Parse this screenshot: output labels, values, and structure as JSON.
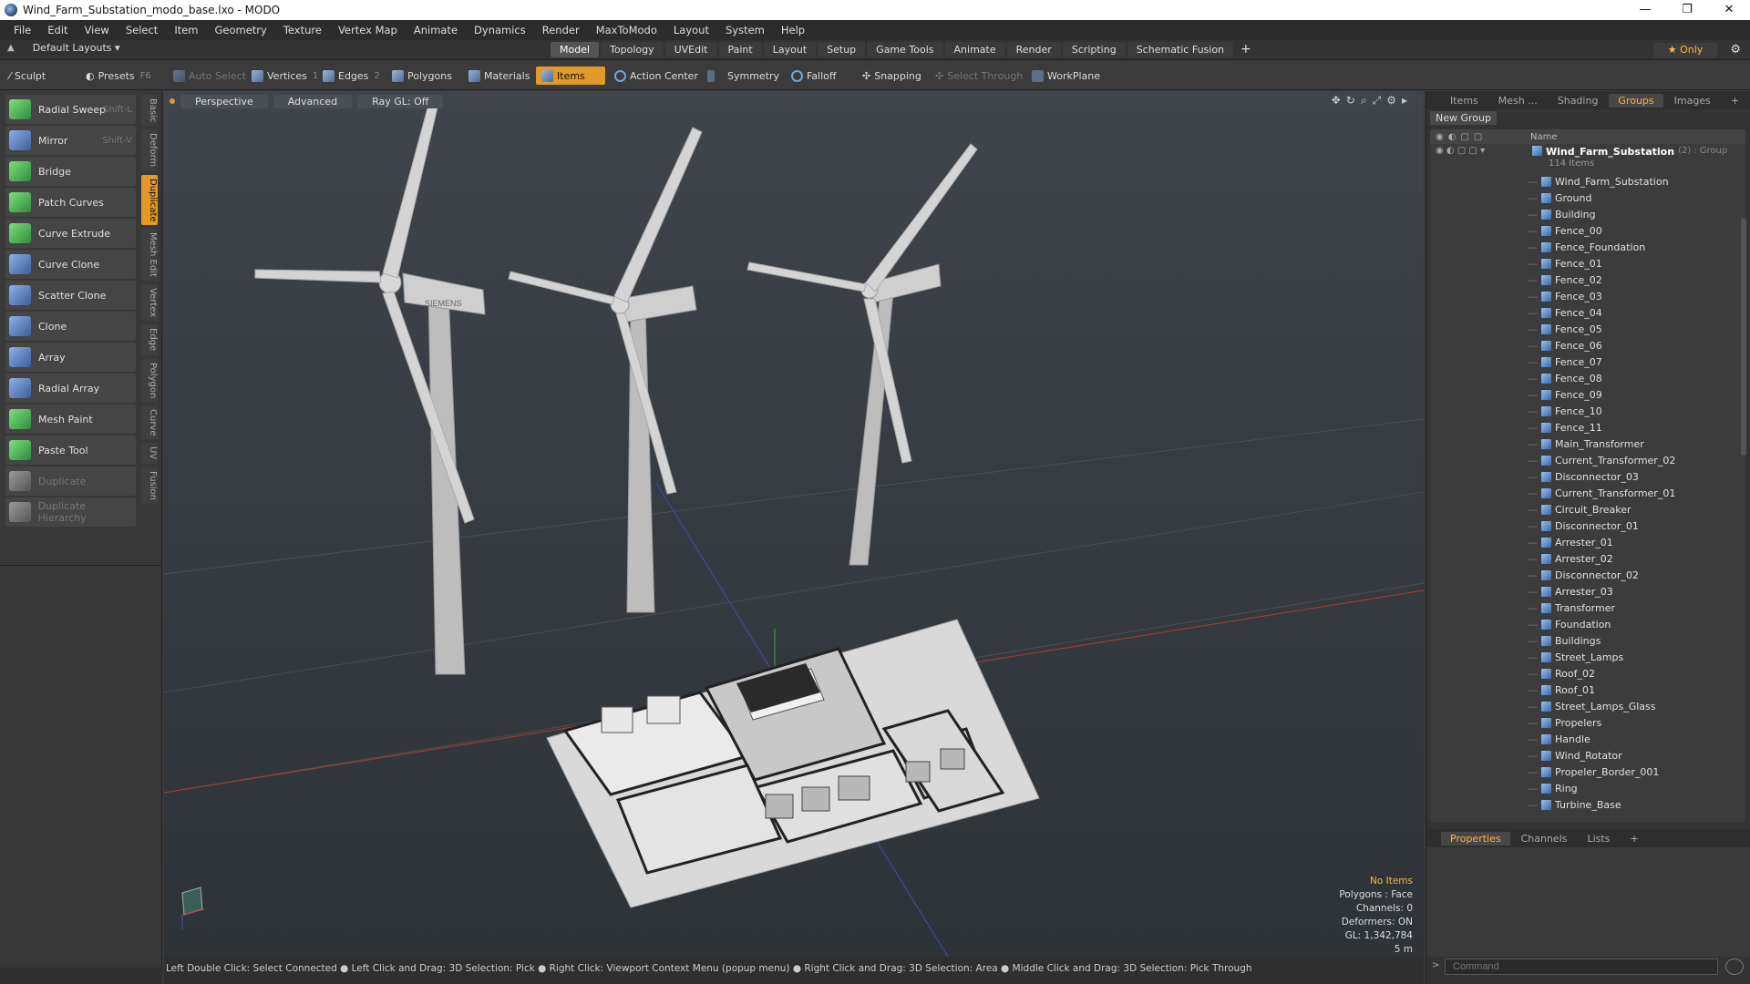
{
  "window": {
    "title": "Wind_Farm_Substation_modo_base.lxo - MODO",
    "min": "—",
    "restore": "❐",
    "close": "✕"
  },
  "menu": [
    "File",
    "Edit",
    "View",
    "Select",
    "Item",
    "Geometry",
    "Texture",
    "Vertex Map",
    "Animate",
    "Dynamics",
    "Render",
    "MaxToModo",
    "Layout",
    "System",
    "Help"
  ],
  "layouts": {
    "label": "Default Layouts ▾"
  },
  "tabs": [
    {
      "label": "Model",
      "active": true
    },
    {
      "label": "Topology"
    },
    {
      "label": "UVEdit"
    },
    {
      "label": "Paint"
    },
    {
      "label": "Layout"
    },
    {
      "label": "Setup"
    },
    {
      "label": "Game Tools"
    },
    {
      "label": "Animate"
    },
    {
      "label": "Render"
    },
    {
      "label": "Scripting"
    },
    {
      "label": "Schematic Fusion"
    }
  ],
  "only_label": "★  Only",
  "toolbar": {
    "sculpt": "Sculpt",
    "presets": "Presets",
    "presets_key": "F6",
    "auto_select": "Auto Select",
    "vertices": "Vertices",
    "vertices_n": "1",
    "edges": "Edges",
    "edges_n": "2",
    "polygons": "Polygons",
    "materials": "Materials",
    "items": "Items",
    "action_center": "Action Center",
    "symmetry": "Symmetry",
    "falloff": "Falloff",
    "snapping": "Snapping",
    "select_through": "Select Through",
    "workplane": "WorkPlane"
  },
  "tools": [
    {
      "label": "Radial Sweep",
      "shortcut": "Shift-L",
      "color": "green"
    },
    {
      "label": "Mirror",
      "shortcut": "Shift-V",
      "color": "blue"
    },
    {
      "label": "Bridge",
      "shortcut": "",
      "color": "green"
    },
    {
      "label": "Patch Curves",
      "shortcut": "",
      "color": "green"
    },
    {
      "label": "Curve Extrude",
      "shortcut": "",
      "color": "green"
    },
    {
      "label": "Curve Clone",
      "shortcut": "",
      "color": "blue"
    },
    {
      "label": "Scatter Clone",
      "shortcut": "",
      "color": "blue"
    },
    {
      "label": "Clone",
      "shortcut": "",
      "color": "blue"
    },
    {
      "label": "Array",
      "shortcut": "",
      "color": "blue"
    },
    {
      "label": "Radial Array",
      "shortcut": "",
      "color": "blue"
    },
    {
      "label": "Mesh Paint",
      "shortcut": "",
      "color": "green"
    },
    {
      "label": "Paste Tool",
      "shortcut": "",
      "color": "green"
    },
    {
      "label": "Duplicate",
      "shortcut": "",
      "color": "gray",
      "disabled": true
    },
    {
      "label": "Duplicate Hierarchy",
      "shortcut": "",
      "color": "gray",
      "disabled": true
    }
  ],
  "vtabs": [
    {
      "label": "Basic"
    },
    {
      "label": "Deform"
    },
    {
      "label": "Duplicate",
      "active": true
    },
    {
      "label": "Mesh Edit"
    },
    {
      "label": "Vertex"
    },
    {
      "label": "Edge"
    },
    {
      "label": "Polygon"
    },
    {
      "label": "Curve"
    },
    {
      "label": "UV"
    },
    {
      "label": "Fusion"
    }
  ],
  "viewport": {
    "perspective": "Perspective",
    "advanced": "Advanced",
    "raygl": "Ray GL: Off",
    "stats": {
      "no_items": "No Items",
      "polygons": "Polygons : Face",
      "channels": "Channels: 0",
      "deformers": "Deformers: ON",
      "gl": "GL: 1,342,784",
      "scale": "5 m"
    },
    "turbine_brand": "SIEMENS"
  },
  "status": "Left Double Click: Select Connected ● Left Click and Drag: 3D Selection: Pick ● Right Click: Viewport Context Menu (popup menu) ● Right Click and Drag: 3D Selection: Area ● Middle Click and Drag: 3D Selection: Pick Through",
  "right_tabs": [
    {
      "label": "Items"
    },
    {
      "label": "Mesh ..."
    },
    {
      "label": "Shading"
    },
    {
      "label": "Groups",
      "active": true
    },
    {
      "label": "Images"
    }
  ],
  "new_group": "New Group",
  "groups": {
    "name_header": "Name",
    "root": {
      "name": "Wind_Farm_Substation",
      "count": "(2)",
      "type": ": Group",
      "items": "114 Items"
    },
    "children": [
      "Wind_Farm_Substation",
      "Ground",
      "Building",
      "Fence_00",
      "Fence_Foundation",
      "Fence_01",
      "Fence_02",
      "Fence_03",
      "Fence_04",
      "Fence_05",
      "Fence_06",
      "Fence_07",
      "Fence_08",
      "Fence_09",
      "Fence_10",
      "Fence_11",
      "Main_Transformer",
      "Current_Transformer_02",
      "Disconnector_03",
      "Current_Transformer_01",
      "Circuit_Breaker",
      "Disconnector_01",
      "Arrester_01",
      "Arrester_02",
      "Disconnector_02",
      "Arrester_03",
      "Transformer",
      "Foundation",
      "Buildings",
      "Street_Lamps",
      "Roof_02",
      "Roof_01",
      "Street_Lamps_Glass",
      "Propelers",
      "Handle",
      "Wind_Rotator",
      "Propeler_Border_001",
      "Ring",
      "Turbine_Base"
    ]
  },
  "bottom_tabs": [
    {
      "label": "Properties",
      "active": true
    },
    {
      "label": "Channels"
    },
    {
      "label": "Lists"
    }
  ],
  "command_placeholder": "Command"
}
